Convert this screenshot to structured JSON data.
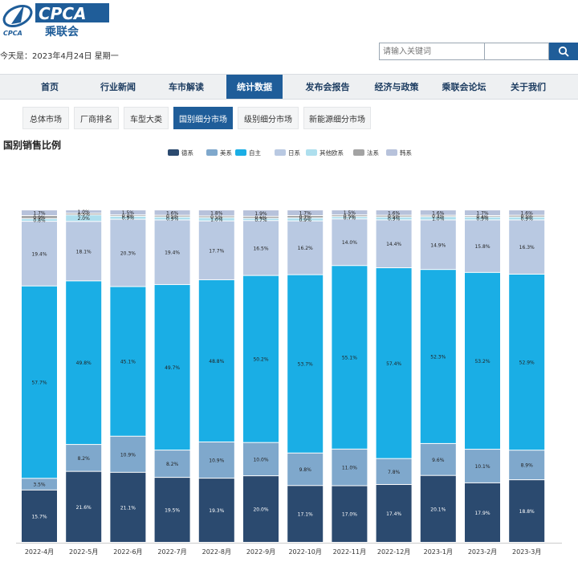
{
  "header": {
    "logo_text": "CPCA",
    "logo_subtext": "乘联会",
    "logo_small": "CPCA",
    "date_prefix": "今天是：",
    "date_value": "2023年4月24日 星期一",
    "search_placeholder": "请输入关键词",
    "search_icon": "search-icon"
  },
  "nav": {
    "items": [
      {
        "label": "首页"
      },
      {
        "label": "行业新闻"
      },
      {
        "label": "车市解读"
      },
      {
        "label": "统计数据",
        "active": true
      },
      {
        "label": "发布会报告"
      },
      {
        "label": "经济与政策"
      },
      {
        "label": "乘联会论坛"
      },
      {
        "label": "关于我们"
      }
    ]
  },
  "subtabs": {
    "items": [
      {
        "label": "总体市场"
      },
      {
        "label": "厂商排名"
      },
      {
        "label": "车型大类"
      },
      {
        "label": "国别细分市场",
        "active": true
      },
      {
        "label": "级别细分市场"
      },
      {
        "label": "新能源细分市场"
      }
    ]
  },
  "chart_data": {
    "type": "bar",
    "stacked": true,
    "title": "国别销售比例",
    "legend_position": "top-center",
    "ylim": [
      0,
      100
    ],
    "categories": [
      "2022-4月",
      "2022-5月",
      "2022-6月",
      "2022-7月",
      "2022-8月",
      "2022-9月",
      "2022-10月",
      "2022-11月",
      "2022-12月",
      "2023-1月",
      "2023-2月",
      "2023-3月"
    ],
    "series": [
      {
        "name": "德系",
        "color": "#2b4a6f",
        "values": [
          15.7,
          21.6,
          21.1,
          19.5,
          19.3,
          20.0,
          17.1,
          17.0,
          17.4,
          20.1,
          17.9,
          18.8
        ]
      },
      {
        "name": "美系",
        "color": "#7fa8cc",
        "values": [
          3.5,
          8.2,
          10.9,
          8.2,
          10.9,
          10.0,
          9.8,
          11.0,
          7.8,
          9.6,
          10.1,
          8.9
        ]
      },
      {
        "name": "自主",
        "color": "#1aaee5",
        "values": [
          57.7,
          49.8,
          45.1,
          49.7,
          48.8,
          50.2,
          53.7,
          55.1,
          57.4,
          52.3,
          53.2,
          52.9
        ]
      },
      {
        "name": "日系",
        "color": "#b9c9e2",
        "values": [
          19.4,
          18.1,
          20.3,
          19.4,
          17.7,
          16.5,
          16.2,
          14.0,
          14.4,
          14.9,
          15.8,
          16.3
        ]
      },
      {
        "name": "其他欧系",
        "color": "#aedfee",
        "values": [
          0.8,
          2.0,
          0.9,
          0.9,
          1.0,
          0.7,
          0.9,
          0.7,
          0.9,
          1.0,
          0.9,
          0.9
        ]
      },
      {
        "name": "法系",
        "color": "#a3a3a3",
        "values": [
          0.9,
          0.5,
          0.4,
          0.5,
          0.5,
          0.6,
          0.7,
          0.5,
          0.5,
          0.4,
          0.4,
          0.5
        ]
      },
      {
        "name": "韩系",
        "color": "#b7c2db",
        "values": [
          1.7,
          1.0,
          1.5,
          1.6,
          1.8,
          1.9,
          1.7,
          1.5,
          1.6,
          1.6,
          1.7,
          1.6
        ]
      }
    ],
    "value_labels": [
      [
        "15.7%",
        "21.6%",
        "21.1%",
        "19.5%",
        "19.3%",
        "20.0%",
        "17.1%",
        "17.0%",
        "17.4%",
        "20.1%",
        "17.9%",
        "18.8%"
      ],
      [
        "3.5%",
        "8.2%",
        "10.9%",
        "8.2%",
        "10.9%",
        "10.0%",
        "9.8%",
        "11.0%",
        "7.8%",
        "9.6%",
        "10.1%",
        "8.9%"
      ],
      [
        "57.7%",
        "49.8%",
        "45.1%",
        "49.7%",
        "48.8%",
        "50.2%",
        "53.7%",
        "55.1%",
        "57.4%",
        "52.3%",
        "53.2%",
        "52.9%"
      ],
      [
        "19.4%",
        "18.1%",
        "20.3%",
        "19.4%",
        "17.7%",
        "16.5%",
        "16.2%",
        "14.0%",
        "14.4%",
        "14.9%",
        "15.8%",
        "16.3%"
      ],
      [
        "0.8%",
        "2.0%",
        "0.9%",
        "0.9%",
        "1.0%",
        "0.7%",
        "0.9%",
        "0.7%",
        "0.9%",
        "1.0%",
        "0.9%",
        "0.9%"
      ],
      [
        "0.9%",
        "0.5%",
        "0.4%",
        "0.5%",
        "0.5%",
        "0.6%",
        "0.7%",
        "0.5%",
        "0.5%",
        "0.4%",
        "0.4%",
        "0.5%"
      ],
      [
        "1.7%",
        "1.0%",
        "1.5%",
        "1.6%",
        "1.8%",
        "1.9%",
        "1.7%",
        "1.5%",
        "1.6%",
        "1.6%",
        "1.7%",
        "1.6%"
      ]
    ]
  }
}
